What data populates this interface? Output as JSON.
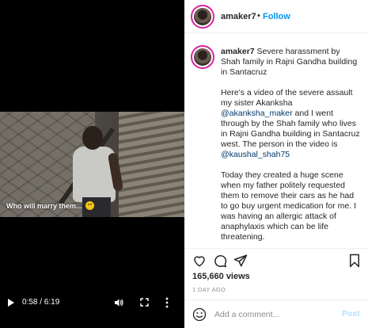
{
  "video": {
    "overlay_caption": "Who will marry them...",
    "time": "0:58 / 6:19",
    "icons": [
      "play-icon",
      "volume-icon",
      "fullscreen-icon",
      "more-vertical-icon"
    ]
  },
  "header": {
    "username": "amaker7",
    "separator": "•",
    "follow_label": "Follow"
  },
  "caption": {
    "username": "amaker7",
    "paragraph_1": "Severe harassment by Shah family in Rajni Gandha building in Santacruz",
    "p2_text_a": "Here's a video of the severe assault my sister Akanksha",
    "p2_mention_1": "@akanksha_maker",
    "p2_text_b": "and I went through by the Shah family who lives in Rajni Gandha building in Santacruz west. The person in the video is",
    "p2_mention_2": "@kaushal_shah75",
    "paragraph_3": "Today they created a huge scene when my father politely requested them to remove their cars as he had to go buy urgent medication for me. I was having an allergic attack of anaphylaxis which can be life threatening."
  },
  "stats": {
    "views": "165,660 views",
    "time_ago": "1 DAY AGO"
  },
  "add_comment": {
    "placeholder": "Add a comment...",
    "post_label": "Post"
  },
  "colors": {
    "link_blue": "#0095f6",
    "mention_blue": "#00376b",
    "post_disabled": "#b2dffc",
    "muted": "#8e8e8e"
  }
}
